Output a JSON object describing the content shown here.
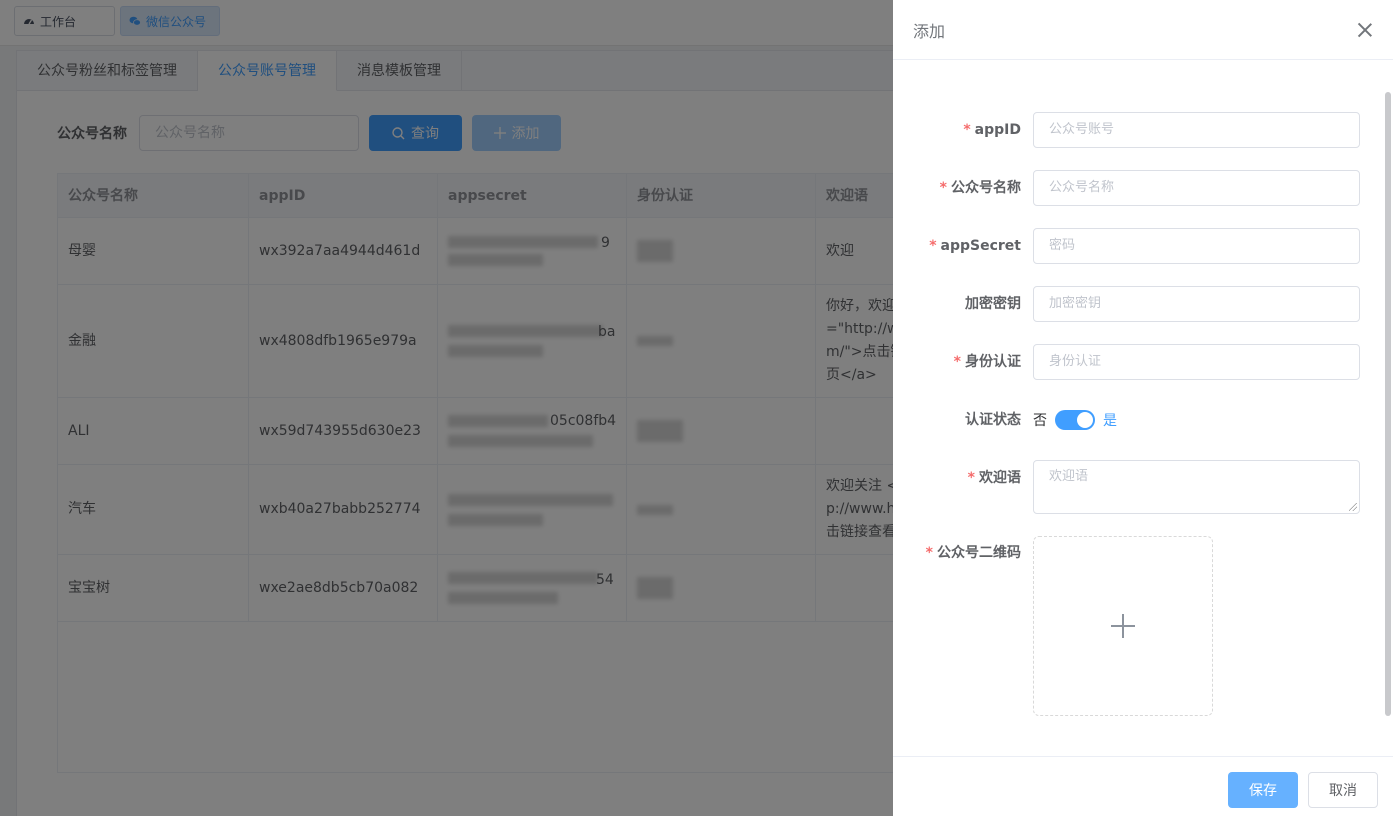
{
  "page_tabs": [
    {
      "label": "工作台",
      "icon": "dashboard-icon"
    },
    {
      "label": "微信公众号",
      "icon": "wechat-icon"
    }
  ],
  "sub_tabs": [
    "公众号粉丝和标签管理",
    "公众号账号管理",
    "消息模板管理"
  ],
  "search": {
    "label": "公众号名称",
    "placeholder": "公众号名称",
    "query_label": "查询",
    "add_label": "添加"
  },
  "table": {
    "columns": [
      "公众号名称",
      "appID",
      "appsecret",
      "身份认证",
      "欢迎语"
    ],
    "rows": [
      {
        "name": "母婴",
        "appid": "wx392a7aa4944d461d",
        "secret_tail": "9",
        "welcome": [
          "欢迎"
        ]
      },
      {
        "name": "金融",
        "appid": "wx4808dfb1965e979a",
        "secret_tail": "ba",
        "welcome": [
          "你好，欢迎",
          "=\"http://w",
          "m/\">点击链",
          "页</a>"
        ]
      },
      {
        "name": "ALI",
        "appid": "wx59d743955d630e23",
        "secret_tail": "05c08fb4",
        "welcome": []
      },
      {
        "name": "汽车",
        "appid": "wxb40a27babb252774",
        "secret_tail": "",
        "welcome": [
          "欢迎关注 <",
          "p://www.h",
          "击链接查看"
        ]
      },
      {
        "name": "宝宝树",
        "appid": "wxe2ae8db5cb70a082",
        "secret_tail": "54",
        "welcome": []
      }
    ]
  },
  "drawer": {
    "title": "添加",
    "fields": {
      "appid": {
        "label": "appID",
        "placeholder": "公众号账号"
      },
      "name": {
        "label": "公众号名称",
        "placeholder": "公众号名称"
      },
      "secret": {
        "label": "appSecret",
        "placeholder": "密码"
      },
      "key": {
        "label": "加密密钥",
        "placeholder": "加密密钥"
      },
      "auth": {
        "label": "身份认证",
        "placeholder": "身份认证"
      },
      "status": {
        "label": "认证状态",
        "off": "否",
        "on": "是",
        "value": true
      },
      "welcome": {
        "label": "欢迎语",
        "placeholder": "欢迎语"
      },
      "qrcode": {
        "label": "公众号二维码"
      }
    },
    "save_label": "保存",
    "cancel_label": "取消"
  },
  "colors": {
    "primary": "#409eff",
    "required": "#f56c6c"
  }
}
